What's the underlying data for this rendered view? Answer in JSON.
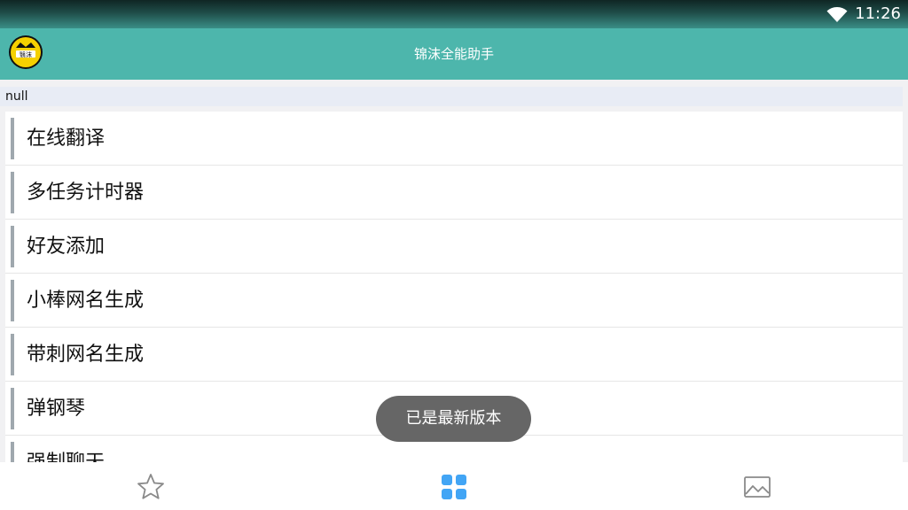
{
  "status_bar": {
    "time": "11:26",
    "wifi_icon": "wifi-icon"
  },
  "app_bar": {
    "logo_text": "翳沫",
    "title": "锦沫全能助手",
    "logo_icon": "crown-icon"
  },
  "subheader": {
    "text": "null"
  },
  "list": {
    "items": [
      {
        "label": "在线翻译"
      },
      {
        "label": "多任务计时器"
      },
      {
        "label": "好友添加"
      },
      {
        "label": "小棒网名生成"
      },
      {
        "label": "带刺网名生成"
      },
      {
        "label": "弹钢琴"
      },
      {
        "label": "强制聊天"
      }
    ]
  },
  "toast": {
    "text": "已是最新版本"
  },
  "bottom_nav": {
    "items": [
      {
        "icon": "star-outline-icon",
        "active": false
      },
      {
        "icon": "grid-apps-icon",
        "active": true
      },
      {
        "icon": "image-icon",
        "active": false
      }
    ],
    "active_color": "#42a5f5",
    "inactive_color": "#8a8a8a"
  },
  "colors": {
    "app_bar": "#4db6ac",
    "toast": "#666666",
    "accent_bar": "#9fa8ae"
  }
}
